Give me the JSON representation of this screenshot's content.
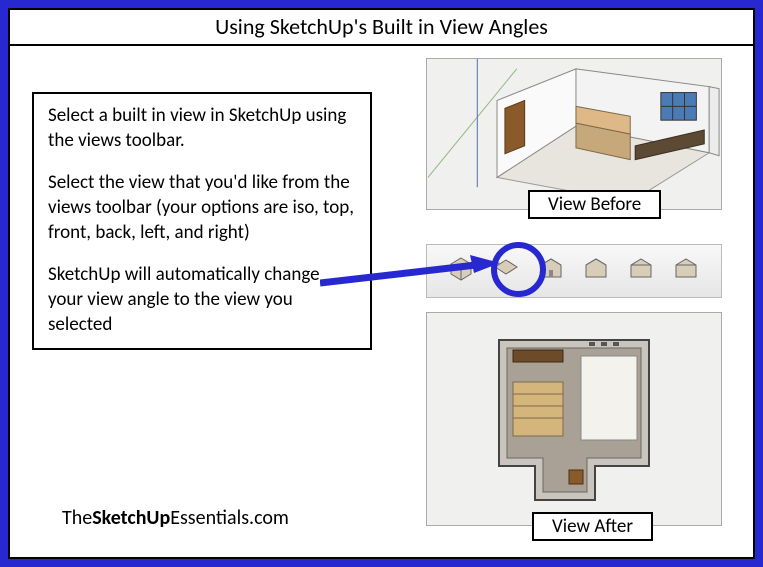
{
  "title": "Using SketchUp's Built in View Angles",
  "instructions": {
    "p1": "Select a built in view in SketchUp using the views toolbar.",
    "p2": "Select the view that you'd like from the views toolbar (your options are iso, top, front, back, left, and right)",
    "p3": "SketchUp will automatically change your view angle to the view you selected"
  },
  "labels": {
    "before": "View Before",
    "after": "View After"
  },
  "branding": {
    "pre": "The",
    "bold1": "SketchUp",
    "mid": "Essentials",
    "post": ".com"
  },
  "toolbar_icons": [
    "iso-view-icon",
    "top-view-icon",
    "front-view-icon",
    "back-view-icon",
    "left-view-icon",
    "right-view-icon"
  ],
  "colors": {
    "frame": "#2828d0",
    "arrow": "#2828d0"
  }
}
